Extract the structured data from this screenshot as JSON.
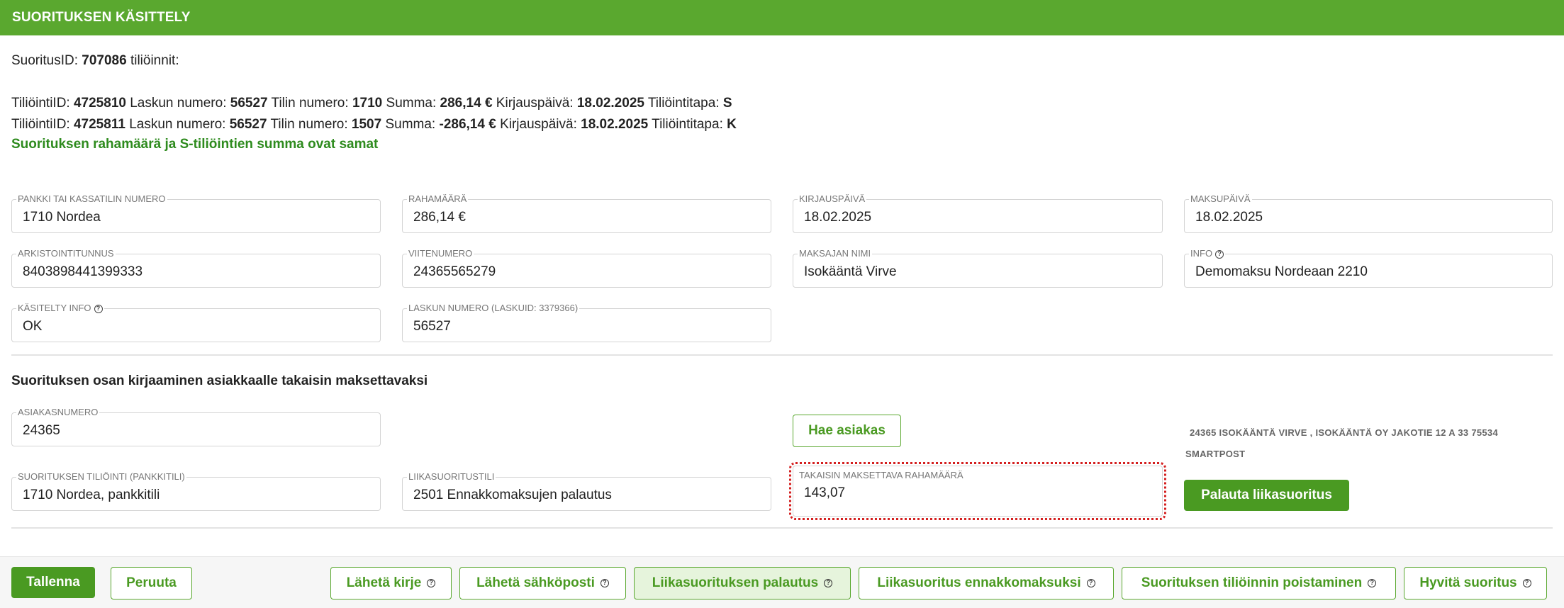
{
  "title": "SUORITUKSEN KÄSITTELY",
  "summary": {
    "id_label": "SuoritusID:",
    "id_value": "707086",
    "id_suffix": "tiliöinnit:"
  },
  "postings": [
    {
      "id_label": "TiliöintiID:",
      "id": "4725810",
      "invoice_label": "Laskun numero:",
      "invoice": "56527",
      "account_label": "Tilin numero:",
      "account": "1710",
      "sum_label": "Summa:",
      "sum": "286,14 €",
      "date_label": "Kirjauspäivä:",
      "date": "18.02.2025",
      "method_label": "Tiliöintitapa:",
      "method": "S"
    },
    {
      "id_label": "TiliöintiID:",
      "id": "4725811",
      "invoice_label": "Laskun numero:",
      "invoice": "56527",
      "account_label": "Tilin numero:",
      "account": "1507",
      "sum_label": "Summa:",
      "sum": "-286,14 €",
      "date_label": "Kirjauspäivä:",
      "date": "18.02.2025",
      "method_label": "Tiliöintitapa:",
      "method": "K"
    }
  ],
  "ok_message": "Suorituksen rahamäärä ja S-tiliöintien summa ovat samat",
  "fields": {
    "bank": {
      "label": "PANKKI TAI KASSATILIN NUMERO",
      "value": "1710 Nordea"
    },
    "amount": {
      "label": "RAHAMÄÄRÄ",
      "value": "286,14 €"
    },
    "booking_date": {
      "label": "KIRJAUSPÄIVÄ",
      "value": "18.02.2025"
    },
    "payment_date": {
      "label": "MAKSUPÄIVÄ",
      "value": "18.02.2025"
    },
    "archive_id": {
      "label": "ARKISTOINTITUNNUS",
      "value": "8403898441399333"
    },
    "reference": {
      "label": "VIITENUMERO",
      "value": "24365565279"
    },
    "payer_name": {
      "label": "MAKSAJAN NIMI",
      "value": "Isokääntä Virve"
    },
    "info": {
      "label": "INFO",
      "value": "Demomaksu Nordeaan 2210"
    },
    "handled_info": {
      "label": "KÄSITELTY INFO",
      "value": "OK"
    },
    "invoice_number": {
      "label": "LASKUN NUMERO (LASKUID: 3379366)",
      "value": "56527"
    }
  },
  "refund_section": {
    "title": "Suorituksen osan kirjaaminen asiakkaalle takaisin maksettavaksi",
    "customer_number": {
      "label": "ASIAKASNUMERO",
      "value": "24365"
    },
    "fetch_customer_label": "Hae asiakas",
    "customer_line1": "24365 ISOKÄÄNTÄ VIRVE , ISOKÄÄNTÄ OY JAKOTIE 12 A 33 75534",
    "customer_line2": "SMARTPOST",
    "payment_account": {
      "label": "SUORITUKSEN TILIÖINTI (PANKKITILI)",
      "value": "1710 Nordea, pankkitili"
    },
    "overpayment_account": {
      "label": "LIIKASUORITUSTILI",
      "value": "2501 Ennakkomaksujen palautus"
    },
    "refund_amount": {
      "label": "TAKAISIN MAKSETTAVA RAHAMÄÄRÄ",
      "value": "143,07"
    },
    "refund_button_label": "Palauta liikasuoritus"
  },
  "footer": {
    "save": "Tallenna",
    "cancel": "Peruuta",
    "send_letter": "Lähetä kirje",
    "send_email": "Lähetä sähköposti",
    "overpayment_refund": "Liikasuorituksen palautus",
    "overpayment_prepayment": "Liikasuoritus ennakkomaksuksi",
    "delete_posting": "Suorituksen tiliöinnin poistaminen",
    "credit_payment": "Hyvitä suoritus"
  },
  "colors": {
    "brand_green": "#5aa82f",
    "ok_text": "#2e8b1e",
    "highlight": "#d42020"
  },
  "icons": {
    "help": "?"
  }
}
